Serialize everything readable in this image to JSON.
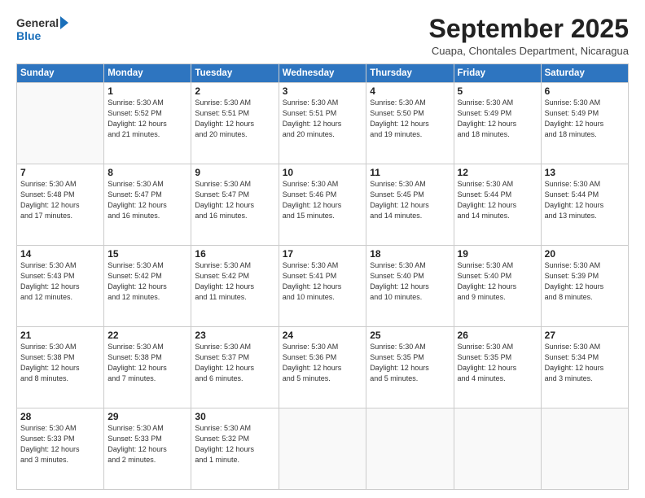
{
  "logo": {
    "line1": "General",
    "line2": "Blue"
  },
  "title": "September 2025",
  "subtitle": "Cuapa, Chontales Department, Nicaragua",
  "header_days": [
    "Sunday",
    "Monday",
    "Tuesday",
    "Wednesday",
    "Thursday",
    "Friday",
    "Saturday"
  ],
  "weeks": [
    [
      {
        "day": "",
        "info": ""
      },
      {
        "day": "1",
        "info": "Sunrise: 5:30 AM\nSunset: 5:52 PM\nDaylight: 12 hours\nand 21 minutes."
      },
      {
        "day": "2",
        "info": "Sunrise: 5:30 AM\nSunset: 5:51 PM\nDaylight: 12 hours\nand 20 minutes."
      },
      {
        "day": "3",
        "info": "Sunrise: 5:30 AM\nSunset: 5:51 PM\nDaylight: 12 hours\nand 20 minutes."
      },
      {
        "day": "4",
        "info": "Sunrise: 5:30 AM\nSunset: 5:50 PM\nDaylight: 12 hours\nand 19 minutes."
      },
      {
        "day": "5",
        "info": "Sunrise: 5:30 AM\nSunset: 5:49 PM\nDaylight: 12 hours\nand 18 minutes."
      },
      {
        "day": "6",
        "info": "Sunrise: 5:30 AM\nSunset: 5:49 PM\nDaylight: 12 hours\nand 18 minutes."
      }
    ],
    [
      {
        "day": "7",
        "info": "Sunrise: 5:30 AM\nSunset: 5:48 PM\nDaylight: 12 hours\nand 17 minutes."
      },
      {
        "day": "8",
        "info": "Sunrise: 5:30 AM\nSunset: 5:47 PM\nDaylight: 12 hours\nand 16 minutes."
      },
      {
        "day": "9",
        "info": "Sunrise: 5:30 AM\nSunset: 5:47 PM\nDaylight: 12 hours\nand 16 minutes."
      },
      {
        "day": "10",
        "info": "Sunrise: 5:30 AM\nSunset: 5:46 PM\nDaylight: 12 hours\nand 15 minutes."
      },
      {
        "day": "11",
        "info": "Sunrise: 5:30 AM\nSunset: 5:45 PM\nDaylight: 12 hours\nand 14 minutes."
      },
      {
        "day": "12",
        "info": "Sunrise: 5:30 AM\nSunset: 5:44 PM\nDaylight: 12 hours\nand 14 minutes."
      },
      {
        "day": "13",
        "info": "Sunrise: 5:30 AM\nSunset: 5:44 PM\nDaylight: 12 hours\nand 13 minutes."
      }
    ],
    [
      {
        "day": "14",
        "info": "Sunrise: 5:30 AM\nSunset: 5:43 PM\nDaylight: 12 hours\nand 12 minutes."
      },
      {
        "day": "15",
        "info": "Sunrise: 5:30 AM\nSunset: 5:42 PM\nDaylight: 12 hours\nand 12 minutes."
      },
      {
        "day": "16",
        "info": "Sunrise: 5:30 AM\nSunset: 5:42 PM\nDaylight: 12 hours\nand 11 minutes."
      },
      {
        "day": "17",
        "info": "Sunrise: 5:30 AM\nSunset: 5:41 PM\nDaylight: 12 hours\nand 10 minutes."
      },
      {
        "day": "18",
        "info": "Sunrise: 5:30 AM\nSunset: 5:40 PM\nDaylight: 12 hours\nand 10 minutes."
      },
      {
        "day": "19",
        "info": "Sunrise: 5:30 AM\nSunset: 5:40 PM\nDaylight: 12 hours\nand 9 minutes."
      },
      {
        "day": "20",
        "info": "Sunrise: 5:30 AM\nSunset: 5:39 PM\nDaylight: 12 hours\nand 8 minutes."
      }
    ],
    [
      {
        "day": "21",
        "info": "Sunrise: 5:30 AM\nSunset: 5:38 PM\nDaylight: 12 hours\nand 8 minutes."
      },
      {
        "day": "22",
        "info": "Sunrise: 5:30 AM\nSunset: 5:38 PM\nDaylight: 12 hours\nand 7 minutes."
      },
      {
        "day": "23",
        "info": "Sunrise: 5:30 AM\nSunset: 5:37 PM\nDaylight: 12 hours\nand 6 minutes."
      },
      {
        "day": "24",
        "info": "Sunrise: 5:30 AM\nSunset: 5:36 PM\nDaylight: 12 hours\nand 5 minutes."
      },
      {
        "day": "25",
        "info": "Sunrise: 5:30 AM\nSunset: 5:35 PM\nDaylight: 12 hours\nand 5 minutes."
      },
      {
        "day": "26",
        "info": "Sunrise: 5:30 AM\nSunset: 5:35 PM\nDaylight: 12 hours\nand 4 minutes."
      },
      {
        "day": "27",
        "info": "Sunrise: 5:30 AM\nSunset: 5:34 PM\nDaylight: 12 hours\nand 3 minutes."
      }
    ],
    [
      {
        "day": "28",
        "info": "Sunrise: 5:30 AM\nSunset: 5:33 PM\nDaylight: 12 hours\nand 3 minutes."
      },
      {
        "day": "29",
        "info": "Sunrise: 5:30 AM\nSunset: 5:33 PM\nDaylight: 12 hours\nand 2 minutes."
      },
      {
        "day": "30",
        "info": "Sunrise: 5:30 AM\nSunset: 5:32 PM\nDaylight: 12 hours\nand 1 minute."
      },
      {
        "day": "",
        "info": ""
      },
      {
        "day": "",
        "info": ""
      },
      {
        "day": "",
        "info": ""
      },
      {
        "day": "",
        "info": ""
      }
    ]
  ]
}
